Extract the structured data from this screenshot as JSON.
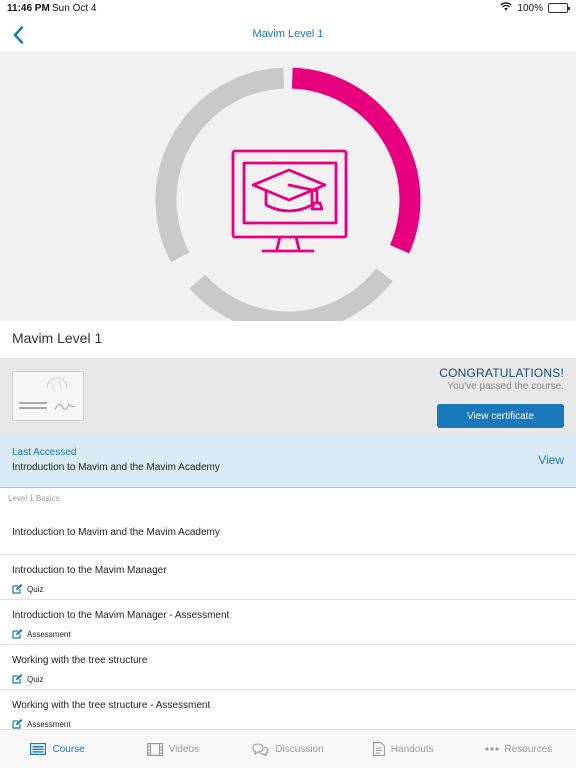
{
  "status_bar": {
    "time": "11:46 PM",
    "date": "Sun Oct 4",
    "battery": "100%"
  },
  "nav": {
    "title": "Mavim Level 1"
  },
  "progress": {
    "completed_fraction": 0.33,
    "accent_color": "#e6007e",
    "track_color": "#c9c9c9"
  },
  "course": {
    "title": "Mavim Level 1",
    "congratulations": "CONGRATULATIONS!",
    "passed_text": "You've passed the course.",
    "certificate_button": "View certificate"
  },
  "last_accessed": {
    "label": "Last Accessed",
    "lesson": "Introduction to Mavim and the Mavim Academy",
    "view_label": "View"
  },
  "section": {
    "title": "Level 1 Basics"
  },
  "lessons": [
    {
      "title": "Introduction to Mavim and the Mavim Academy",
      "type": ""
    },
    {
      "title": "Introduction to the Mavim Manager",
      "type": "Quiz"
    },
    {
      "title": "Introduction to the Mavim Manager - Assessment",
      "type": "Assessment"
    },
    {
      "title": "Working with the tree structure",
      "type": "Quiz"
    },
    {
      "title": "Working with the tree structure - Assessment",
      "type": "Assessment"
    }
  ],
  "tabs": [
    {
      "label": "Course",
      "icon": "course-icon",
      "active": true
    },
    {
      "label": "Videos",
      "icon": "film-icon",
      "active": false
    },
    {
      "label": "Discussion",
      "icon": "chat-bubbles-icon",
      "active": false
    },
    {
      "label": "Handouts",
      "icon": "document-icon",
      "active": false
    },
    {
      "label": "Resources",
      "icon": "more-dots-icon",
      "active": false
    }
  ],
  "colors": {
    "brand_blue": "#1779ba",
    "highlight_bg": "#daebf5"
  }
}
